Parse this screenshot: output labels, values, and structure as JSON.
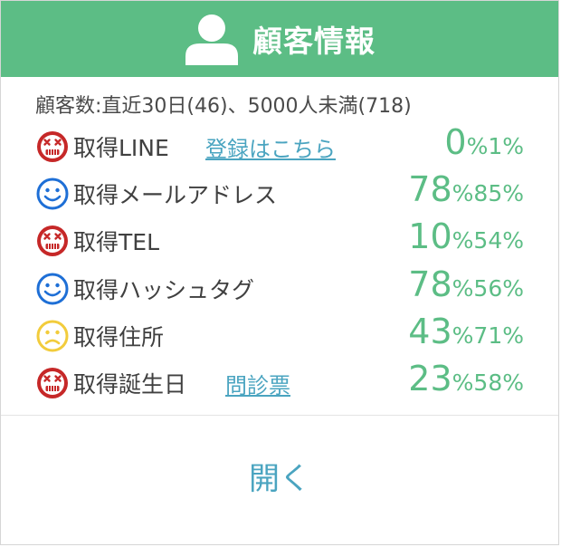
{
  "header": {
    "title": "顧客情報",
    "icon": "person-icon"
  },
  "summary": "顧客数:直近30日(46)、5000人未満(718)",
  "rows": [
    {
      "face": "bad",
      "label": "取得LINE",
      "link": "登録はこちら",
      "value": "0",
      "secondary": "1",
      "unit": "%"
    },
    {
      "face": "good",
      "label": "取得メールアドレス",
      "link": "",
      "value": "78",
      "secondary": "85",
      "unit": "%"
    },
    {
      "face": "bad",
      "label": "取得TEL",
      "link": "",
      "value": "10",
      "secondary": "54",
      "unit": "%"
    },
    {
      "face": "good",
      "label": "取得ハッシュタグ",
      "link": "",
      "value": "78",
      "secondary": "56",
      "unit": "%"
    },
    {
      "face": "neutral",
      "label": "取得住所",
      "link": "",
      "value": "43",
      "secondary": "71",
      "unit": "%"
    },
    {
      "face": "bad",
      "label": "取得誕生日",
      "link": "問診票",
      "value": "23",
      "secondary": "58",
      "unit": "%"
    }
  ],
  "footer": {
    "open_label": "開く"
  },
  "colors": {
    "accent": "#5cbd85",
    "link": "#4aa4c0",
    "bad": "#c62828",
    "good": "#1e6fd6",
    "neutral": "#f2cc3c"
  }
}
